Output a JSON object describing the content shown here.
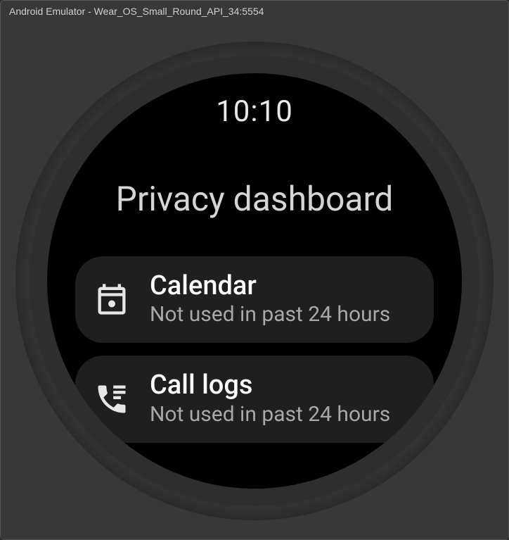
{
  "window": {
    "title": "Android Emulator - Wear_OS_Small_Round_API_34:5554"
  },
  "watch": {
    "clock": "10:10",
    "page_title": "Privacy dashboard",
    "items": [
      {
        "icon": "calendar-icon",
        "title": "Calendar",
        "subtitle": "Not used in past 24 hours"
      },
      {
        "icon": "phone-list-icon",
        "title": "Call logs",
        "subtitle": "Not used in past 24 hours"
      }
    ]
  }
}
